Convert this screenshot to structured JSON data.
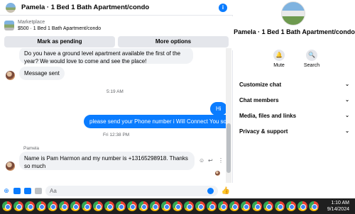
{
  "header": {
    "title": "Pamela · 1 Bed 1 Bath Apartment/condo"
  },
  "marketplace": {
    "label": "Marketplace",
    "item": "$500 · 1 Bed 1 Bath Apartment/condo",
    "mark_pending": "Mark as pending",
    "more_options": "More options"
  },
  "messages": {
    "m1": "Do you have a ground level apartment available the first of the year? We would love to come and see the place!",
    "m2": "Message sent",
    "ts1": "5:19 AM",
    "out1": "Hi",
    "out2": "please send your Phone number i Will Connect You soon",
    "ts2": "Fri 12:38 PM",
    "sender": "Pamela",
    "m3": "Name is Pam Harmon and my number is +13165298918. Thanks so much"
  },
  "composer": {
    "placeholder": "Aa",
    "like": "👍"
  },
  "side": {
    "title": "Pamela · 1 Bed 1 Bath Apartment/condo",
    "mute": "Mute",
    "search": "Search",
    "menu": [
      "Customize chat",
      "Chat members",
      "Media, files and links",
      "Privacy & support"
    ]
  },
  "taskbar": {
    "time": "1:10 AM",
    "date": "9/14/2024"
  },
  "colors": {
    "accent": "#0a7cff",
    "bubble_in": "#f0f2f5",
    "taskbar": "#1f1f1f"
  }
}
